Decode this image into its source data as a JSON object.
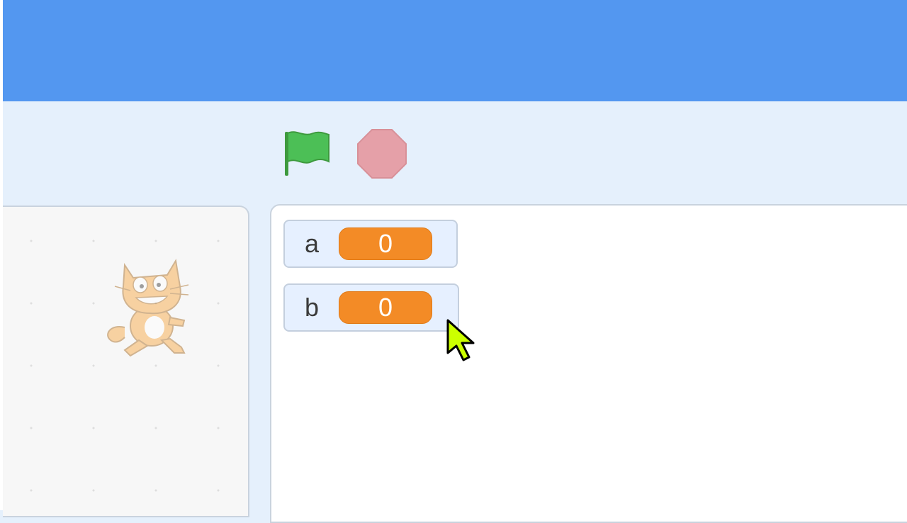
{
  "controls": {
    "green_flag_icon": "green-flag-icon",
    "stop_icon": "stop-sign-icon"
  },
  "monitors": [
    {
      "label": "a",
      "value": "0"
    },
    {
      "label": "b",
      "value": "0"
    }
  ],
  "colors": {
    "menu_bar": "#5397f0",
    "background": "#e5f0fc",
    "monitor_value": "#f38b26",
    "flag": "#4cbf56",
    "stop": "#e5a0a8"
  }
}
